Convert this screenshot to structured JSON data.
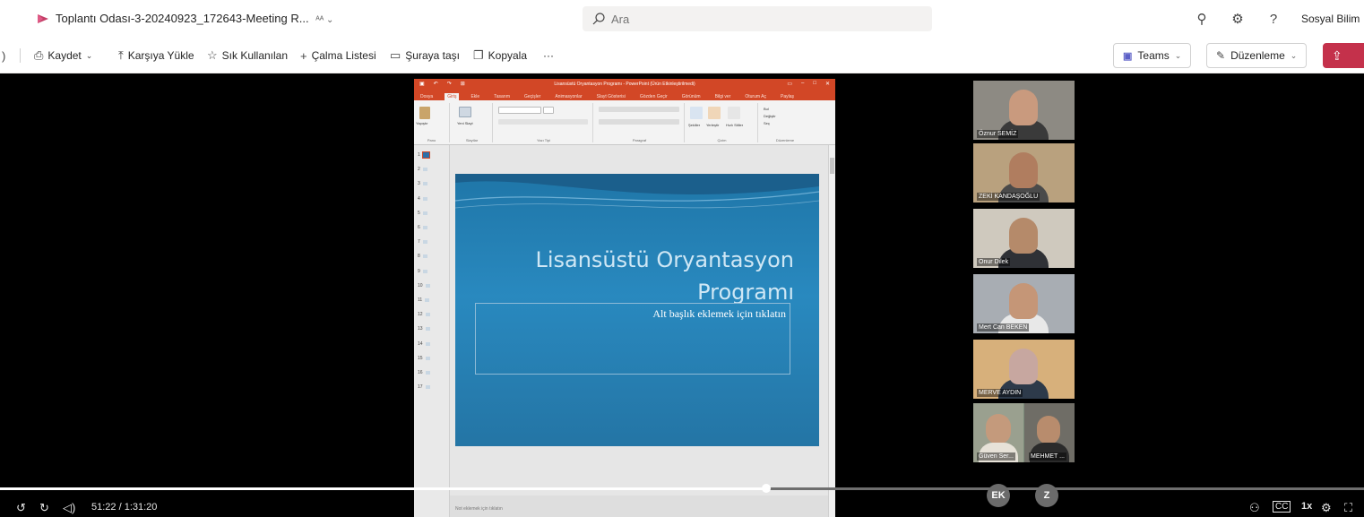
{
  "header": {
    "doc_title": "Toplantı Odası-3-20240923_172643-Meeting R...",
    "title_suffix_icon": "label-icon",
    "search_placeholder": "Ara",
    "account_name": "Sosyal Bilim"
  },
  "toolbar": {
    "save_label": "Kaydet",
    "upload_label": "Karşıya Yükle",
    "favorites_label": "Sık Kullanılan",
    "playlist_label": "Çalma Listesi",
    "move_label": "Şuraya taşı",
    "copy_label": "Kopyala",
    "more_label": "···",
    "teams_label": "Teams",
    "edit_label": "Düzenleme"
  },
  "ppt": {
    "window_title": "Lisansüstü Oryantasyon Programı - PowerPoint (Ürün Etkinleştirilmedi)",
    "tabs": [
      "Dosya",
      "Giriş",
      "Ekle",
      "Tasarım",
      "Geçişler",
      "Animasyonlar",
      "Slayt Gösterisi",
      "Gözden Geçir",
      "Görünüm",
      "Bilgi ver",
      "Oturum Aç",
      "Paylaş"
    ],
    "ribbon_groups": [
      "Pano",
      "Slaytlar",
      "Yazı Tipi",
      "Paragraf",
      "Çizim",
      "Düzenleme"
    ],
    "ribbon_labels": {
      "paste": "Yapıştır",
      "new_slide": "Yeni Slayt",
      "shapes": "Şekiller",
      "arrange": "Yerleştir",
      "quick_styles": "Hızlı Stiller",
      "find": "Bul",
      "replace": "Değiştir",
      "select": "Seç"
    },
    "slide_numbers": [
      "1",
      "2",
      "3",
      "4",
      "5",
      "6",
      "7",
      "8",
      "9",
      "10",
      "11",
      "12",
      "13",
      "14",
      "15",
      "16",
      "17"
    ],
    "slide_title_line1": "Lisansüstü Oryantasyon",
    "slide_title_line2": "Programı",
    "slide_subtitle": "Alt başlık eklemek için tıklatın",
    "notes_placeholder": "Not eklemek için tıklatın"
  },
  "participants": [
    {
      "name": "Öznur SEMİZ"
    },
    {
      "name": "ZEKİ KANDAŞOĞLU"
    },
    {
      "name": "Onur Dilek"
    },
    {
      "name": "Mert Can BEKEN"
    },
    {
      "name": "MERVE AYDIN"
    },
    {
      "name": "Güven Ser..."
    },
    {
      "name": "MEHMET ..."
    }
  ],
  "player": {
    "time_text": "51:22 / 1:31:20",
    "progress": 0.562,
    "speed": "1x",
    "avatars": [
      "EK",
      "Z"
    ]
  },
  "colors": {
    "accent_red": "#c4314b",
    "ppt_orange": "#d24726",
    "slide_blue": "#2989bf"
  }
}
